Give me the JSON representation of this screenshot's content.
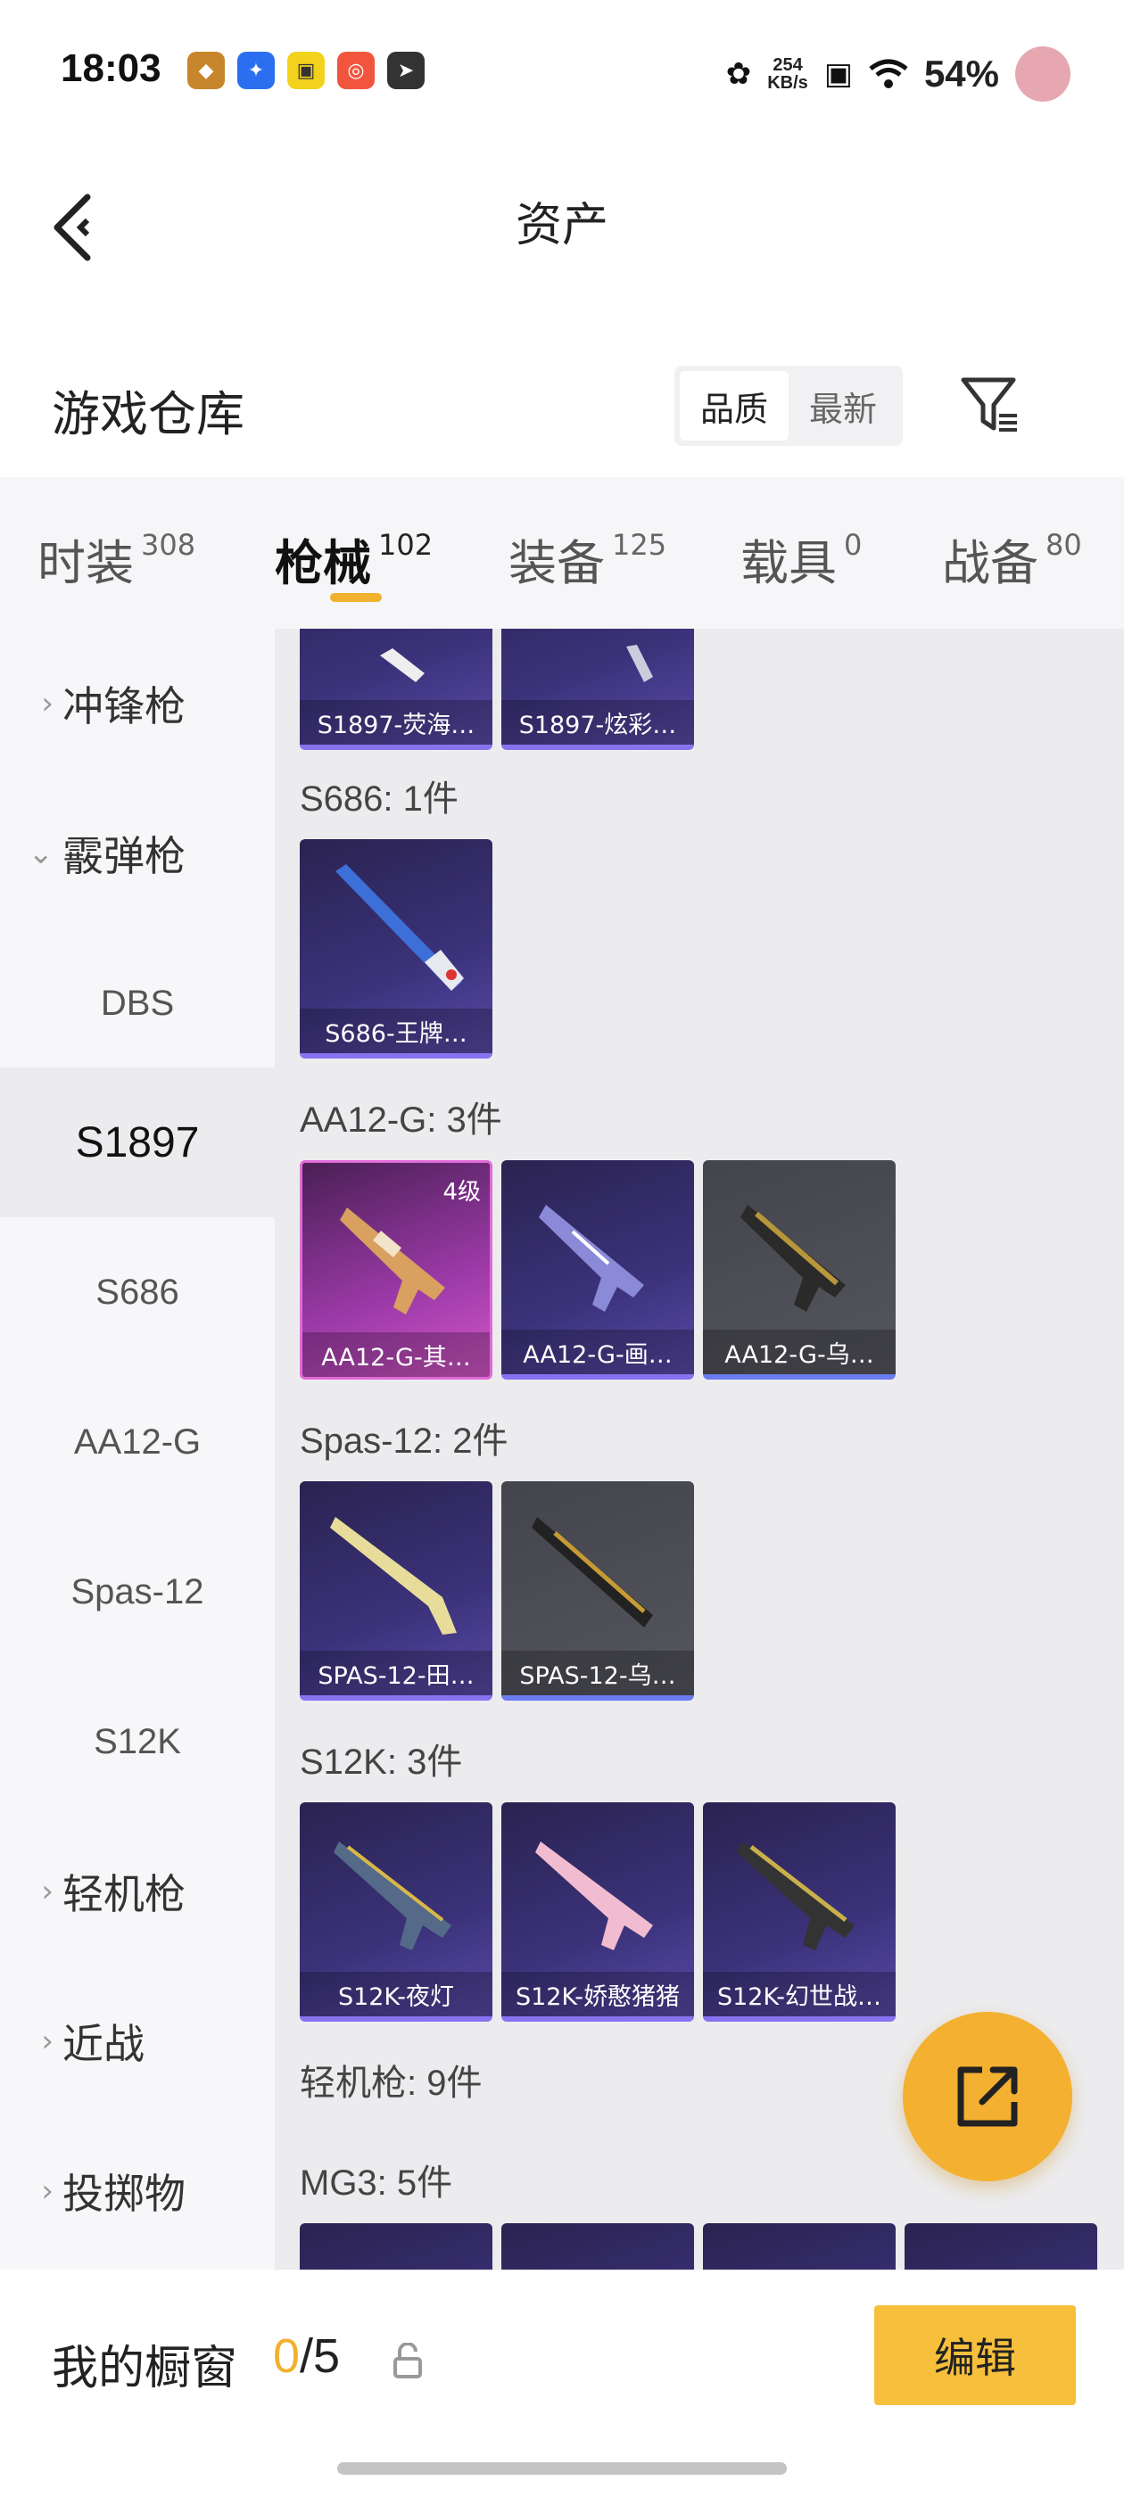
{
  "status_bar": {
    "time": "18:03",
    "net_speed_value": "254",
    "net_speed_unit": "KB/s",
    "battery": "54%",
    "app_icons": [
      "game-app-icon",
      "shield-app-icon",
      "pay-app-icon",
      "video-app-icon",
      "send-app-icon"
    ]
  },
  "header": {
    "title": "资产"
  },
  "warehouse": {
    "title": "游戏仓库",
    "sort_options": [
      "品质",
      "最新"
    ],
    "sort_selected": "品质"
  },
  "tabs": [
    {
      "label": "时装",
      "count": "308"
    },
    {
      "label": "枪械",
      "count": "102",
      "active": true
    },
    {
      "label": "装备",
      "count": "125"
    },
    {
      "label": "载具",
      "count": "0"
    },
    {
      "label": "战备",
      "count": "80"
    }
  ],
  "sidebar": {
    "items": [
      {
        "label": "冲锋枪",
        "type": "category",
        "expanded": false
      },
      {
        "label": "霰弹枪",
        "type": "category",
        "expanded": true
      },
      {
        "label": "DBS",
        "type": "sub"
      },
      {
        "label": "S1897",
        "type": "sub",
        "selected": true
      },
      {
        "label": "S686",
        "type": "sub"
      },
      {
        "label": "AA12-G",
        "type": "sub"
      },
      {
        "label": "Spas-12",
        "type": "sub"
      },
      {
        "label": "S12K",
        "type": "sub"
      },
      {
        "label": "轻机枪",
        "type": "category",
        "expanded": false
      },
      {
        "label": "近战",
        "type": "category",
        "expanded": false
      },
      {
        "label": "投掷物",
        "type": "category",
        "expanded": false
      }
    ]
  },
  "content": {
    "top_cards": [
      {
        "name": "S1897-荧海…",
        "rarity": "purple"
      },
      {
        "name": "S1897-炫彩…",
        "rarity": "purple"
      }
    ],
    "groups": [
      {
        "label": "S686: 1件",
        "cards": [
          {
            "name": "S686-王牌…",
            "rarity": "purple",
            "gun_color": "#3d6fd8"
          }
        ]
      },
      {
        "label": "AA12-G: 3件",
        "cards": [
          {
            "name": "AA12-G-其…",
            "rarity": "pink",
            "badge": "4级",
            "gun_color": "#d9a060"
          },
          {
            "name": "AA12-G-画…",
            "rarity": "purple",
            "gun_color": "#8a8ad8"
          },
          {
            "name": "AA12-G-乌…",
            "rarity": "gray",
            "gun_color": "#b8963a"
          }
        ]
      },
      {
        "label": "Spas-12: 2件",
        "cards": [
          {
            "name": "SPAS-12-田…",
            "rarity": "purple",
            "gun_color": "#e8dc9a"
          },
          {
            "name": "SPAS-12-乌…",
            "rarity": "gray",
            "gun_color": "#c79a34"
          }
        ]
      },
      {
        "label": "S12K: 3件",
        "cards": [
          {
            "name": "S12K-夜灯",
            "rarity": "purple",
            "gun_color": "#556a88"
          },
          {
            "name": "S12K-娇憨猪猪",
            "rarity": "purple",
            "gun_color": "#f2bcd0"
          },
          {
            "name": "S12K-幻世战…",
            "rarity": "purple",
            "gun_color": "#c9b04a"
          }
        ]
      }
    ],
    "section_label": "轻机枪: 9件",
    "mg3_label": "MG3: 5件"
  },
  "bottom": {
    "showcase_label": "我的橱窗",
    "showcase_current": "0",
    "showcase_total": "/5",
    "edit_label": "编辑"
  },
  "colors": {
    "accent": "#f0b12e",
    "edit_button": "#f6bf3c",
    "purple_rarity": "#8872f0",
    "pink_rarity": "#e06ad8"
  }
}
